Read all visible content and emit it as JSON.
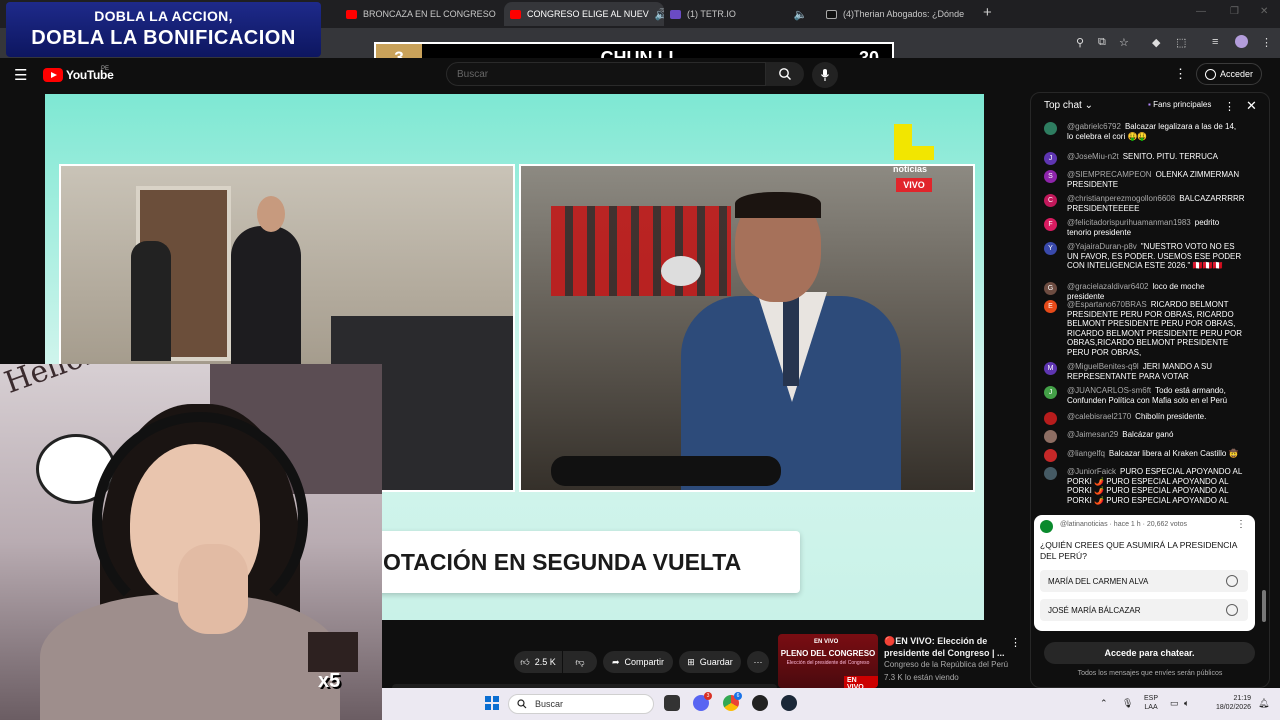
{
  "browser": {
    "tabs": [
      {
        "label": "BRONCAZA EN EL CONGRESO",
        "favicon_color": "#ff0000"
      },
      {
        "label": "CONGRESO ELIGE AL NUEV",
        "favicon_color": "#ff0000",
        "active": true
      },
      {
        "label": "(1) TETR.IO",
        "favicon_color": "#6a4bc4"
      },
      {
        "label": "(4)Therian Abogados: ¿Dónde",
        "favicon_color": "#111111"
      }
    ]
  },
  "overlay": {
    "promo_line1": "DOBLA LA ACCION,",
    "promo_line2": "DOBLA LA BONIFICACION",
    "score_left": "3",
    "score_name": "CHUN LI",
    "score_right": "30"
  },
  "youtube": {
    "logo_text": "YouTube",
    "country_code": "PE",
    "search_placeholder": "Buscar",
    "signin_label": "Acceder"
  },
  "video": {
    "channel_logo_text": "noticias",
    "live_badge": "VIVO",
    "caption": "OTACIÓN EN SEGUNDA VUELTA",
    "likes": "2.5 K",
    "share_label": "Compartir",
    "save_label": "Guardar"
  },
  "webcam": {
    "wall_text": "HelloKitty",
    "emote_multiplier": "x5"
  },
  "related": {
    "thumb_live": "EN VIVO",
    "thumb_title": "PLENO DEL CONGRESO",
    "thumb_subtitle": "Elección del presidente del Congreso",
    "thumb_badge": "EN VIVO",
    "title": "🔴EN VIVO:  Elección de presidente del Congreso | ...",
    "channel": "Congreso de la República del Perú",
    "views": "7.3 K lo están viendo"
  },
  "chat": {
    "header": "Top chat",
    "fans_label": "Fans principales",
    "messages": [
      {
        "author": "@gabrielc6792",
        "text": "Balcazar legalizara a las de 14, lo celebra el cori 🤑🤑",
        "avatar_color": "#2e7d60",
        "initial": ""
      },
      {
        "author": "@JoseMiu-n2t",
        "text": "SENITO. PITU. TERRUCA",
        "avatar_color": "#5e35b1",
        "initial": "J"
      },
      {
        "author": "@SIEMPRECAMPEON",
        "text": "OLENKA ZIMMERMAN PRESIDENTE",
        "avatar_color": "#8e24aa",
        "initial": "S"
      },
      {
        "author": "@christianperezmogollon6608",
        "text": "BALCAZARRRRR PRESIDENTEEEEE",
        "avatar_color": "#c2185b",
        "initial": "C"
      },
      {
        "author": "@felicitadorispurihuamanman1983",
        "text": "pedrito tenorio presidente",
        "avatar_color": "#d81b60",
        "initial": "F"
      },
      {
        "author": "@YajairaDuran-p8v",
        "text": "\"NUESTRO VOTO NO ES UN FAVOR, ES PODER. USEMOS ESE PODER CON INTELIGENCIA ESTE 2026.\" 🇵🇪🇵🇪🇵🇪",
        "avatar_color": "#3949ab",
        "initial": "Y"
      },
      {
        "author": "@gracielazaldivar6402",
        "text": "loco de moche presidente",
        "avatar_color": "#6d4c41",
        "initial": "G"
      },
      {
        "author": "@Espartano670BRAS",
        "text": "RICARDO BELMONT PRESIDENTE PERU POR OBRAS, RICARDO BELMONT PRESIDENTE PERU POR OBRAS, RICARDO BELMONT PRESIDENTE PERU POR OBRAS,RICARDO BELMONT PRESIDENTE PERU POR OBRAS,",
        "avatar_color": "#e64a19",
        "initial": "E"
      },
      {
        "author": "@MiguelBenites-q9l",
        "text": "JERI MANDO A SU REPRESENTANTE PARA VOTAR",
        "avatar_color": "#5e35b1",
        "initial": "M"
      },
      {
        "author": "@JUANCARLOS-sm6ft",
        "text": "Todo está armando, Confunden Política con Mafia solo en el Perú",
        "avatar_color": "#43a047",
        "initial": "J"
      },
      {
        "author": "@calebisrael2170",
        "text": "Chibolín presidente.",
        "avatar_color": "#b71c1c",
        "initial": ""
      },
      {
        "author": "@Jaimesan29",
        "text": "Balcázar ganó",
        "avatar_color": "#8d6e63",
        "initial": ""
      },
      {
        "author": "@liangelfq",
        "text": "Balcazar libera al Kraken Castillo 🤠",
        "avatar_color": "#c62828",
        "initial": ""
      },
      {
        "author": "@JuniorFaick",
        "text": "PURO ESPECIAL APOYANDO AL PORKI 🌶️ PURO ESPECIAL APOYANDO AL PORKI 🌶️ PURO ESPECIAL APOYANDO AL PORKI 🌶️ PURO ESPECIAL APOYANDO AL",
        "avatar_color": "#455a64",
        "initial": ""
      }
    ],
    "poll": {
      "channel": "@latinanoticias",
      "meta": "@latinanoticias · hace 1 h · 20,662 votos",
      "question": "¿QUIÉN CREES QUE ASUMIRÁ LA PRESIDENCIA DEL PERÚ?",
      "options": [
        "MARÍA DEL CARMEN ALVA",
        "JOSÉ MARÍA BÁLCAZAR"
      ]
    },
    "cta_label": "Accede para chatear.",
    "note": "Todos los mensajes que envíes serán públicos"
  },
  "taskbar": {
    "search_label": "Buscar",
    "lang_line1": "ESP",
    "lang_line2": "LAA",
    "time": "21:19",
    "date": "18/02/2026",
    "badge_discord": "3",
    "badge_chrome": "6"
  }
}
